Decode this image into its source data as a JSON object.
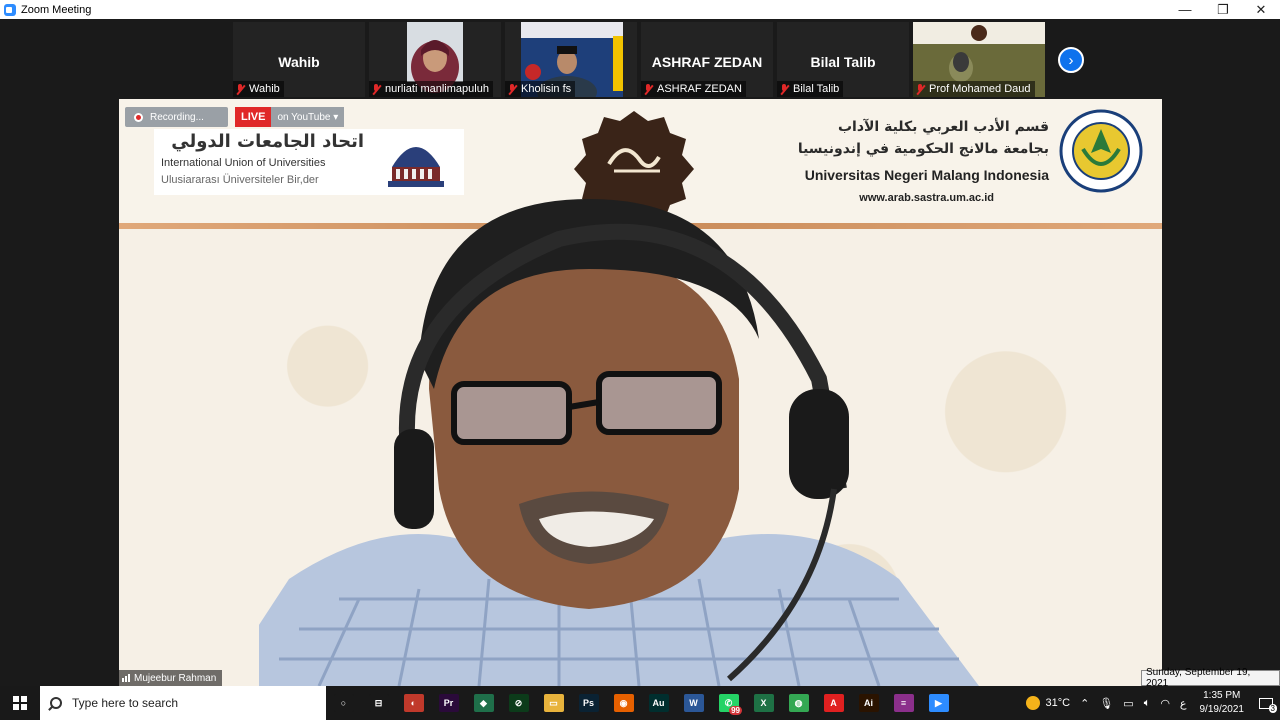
{
  "window": {
    "title": "Zoom Meeting",
    "minimize": "—",
    "maximize": "❐",
    "close": "✕"
  },
  "participants": [
    {
      "name": "Wahib",
      "big_name": "Wahib",
      "muted": true,
      "video": false
    },
    {
      "name": "nurliati manlimapuluh",
      "big_name": "",
      "muted": true,
      "video": true
    },
    {
      "name": "Kholisin fs",
      "big_name": "",
      "muted": true,
      "video": true
    },
    {
      "name": "ASHRAF ZEDAN",
      "big_name": "ASHRAF ZEDAN",
      "muted": true,
      "video": false
    },
    {
      "name": "Bilal Talib",
      "big_name": "Bilal Talib",
      "muted": true,
      "video": false
    },
    {
      "name": "Prof Mohamed Daud",
      "big_name": "",
      "muted": true,
      "video": true
    }
  ],
  "next_arrow": "›",
  "recording": {
    "label": "Recording..."
  },
  "live": {
    "badge": "LIVE",
    "platform": "on YouTube",
    "caret": "▾"
  },
  "banner": {
    "iuu_arabic": "اتحاد الجامعات الدولي",
    "iuu_english": "International Union of Universities",
    "iuu_turkish": "Ulusiararası Üniversiteler Bir,der",
    "uni_arabic_1": "قسم الأدب العربي بكلية الآداب",
    "uni_arabic_2": "بجامعة مالانج الحكومية في إندونيسيا",
    "uni_english": "Universitas Negeri Malang Indonesia",
    "uni_website": "www.arab.sastra.um.ac.id"
  },
  "speaker": {
    "name": "Mujeebur Rahman"
  },
  "tooltip": "Sunday, September 19, 2021",
  "taskbar": {
    "search_placeholder": "Type here to search",
    "apps": [
      {
        "name": "cortana",
        "glyph": "○",
        "color": "#191919"
      },
      {
        "name": "task-view",
        "glyph": "⊟",
        "color": "#191919"
      },
      {
        "name": "app-red",
        "glyph": "◐",
        "color": "#c0392b"
      },
      {
        "name": "premiere",
        "glyph": "Pr",
        "color": "#2a0a3a"
      },
      {
        "name": "app-green-diamond",
        "glyph": "◆",
        "color": "#1f6f4a"
      },
      {
        "name": "app-camtasia",
        "glyph": "⊘",
        "color": "#0c3b1a"
      },
      {
        "name": "file-explorer",
        "glyph": "▭",
        "color": "#e8b33c"
      },
      {
        "name": "photoshop",
        "glyph": "Ps",
        "color": "#0a2233"
      },
      {
        "name": "firefox",
        "glyph": "◉",
        "color": "#e66000"
      },
      {
        "name": "audition",
        "glyph": "Au",
        "color": "#002e2e"
      },
      {
        "name": "word",
        "glyph": "W",
        "color": "#2b5797"
      },
      {
        "name": "whatsapp",
        "glyph": "✆",
        "color": "#25d366",
        "badge": "99"
      },
      {
        "name": "excel",
        "glyph": "X",
        "color": "#1e7145"
      },
      {
        "name": "chrome",
        "glyph": "◍",
        "color": "#34a853"
      },
      {
        "name": "acrobat",
        "glyph": "A",
        "color": "#e02020"
      },
      {
        "name": "illustrator",
        "glyph": "Ai",
        "color": "#2a1300"
      },
      {
        "name": "winrar",
        "glyph": "≡",
        "color": "#8b2f8b"
      },
      {
        "name": "zoom",
        "glyph": "▶",
        "color": "#2d8cff"
      }
    ],
    "weather": "31°C",
    "language": "ع",
    "time": "1:35 PM",
    "date": "9/19/2021",
    "notifications": "3"
  }
}
